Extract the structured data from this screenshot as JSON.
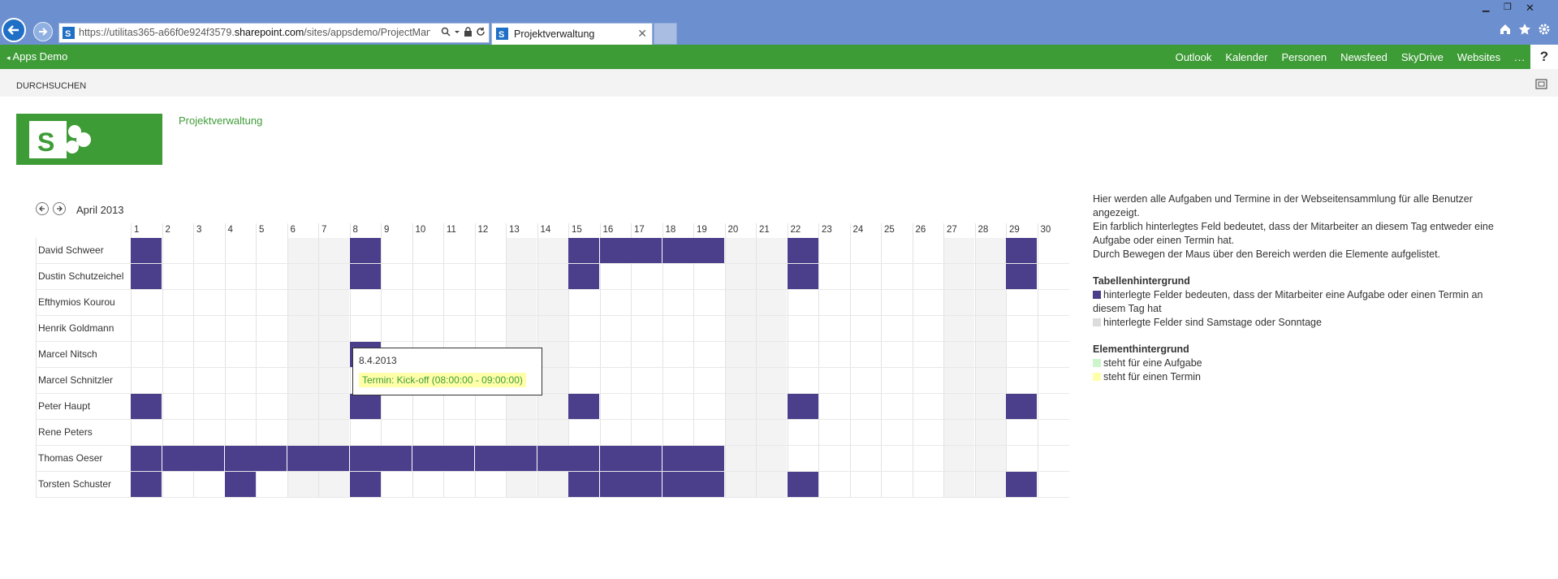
{
  "browser": {
    "url_prefix": "https://utilitas365-a66f0e924f3579.",
    "url_domain": "sharepoint.com",
    "url_path": "/sites/appsdemo/ProjectManage",
    "tab_title": "Projektverwaltung"
  },
  "suite": {
    "site_link": "Apps Demo",
    "nav": [
      "Outlook",
      "Kalender",
      "Personen",
      "Newsfeed",
      "SkyDrive",
      "Websites"
    ],
    "more": "...",
    "help": "?"
  },
  "ribbon": {
    "browse": "DURCHSUCHEN"
  },
  "site": {
    "title": "Projektverwaltung"
  },
  "calendar": {
    "month": "April 2013",
    "days": [
      "1",
      "2",
      "3",
      "4",
      "5",
      "6",
      "7",
      "8",
      "9",
      "10",
      "11",
      "12",
      "13",
      "14",
      "15",
      "16",
      "17",
      "18",
      "19",
      "20",
      "21",
      "22",
      "23",
      "24",
      "25",
      "26",
      "27",
      "28",
      "29",
      "30"
    ],
    "weekend_days": [
      6,
      7,
      13,
      14,
      20,
      21,
      27,
      28
    ],
    "rows": [
      {
        "name": "David Schweer",
        "busy": [
          1,
          8,
          15,
          16,
          17,
          18,
          19,
          22,
          29
        ]
      },
      {
        "name": "Dustin Schutzeichel",
        "busy": [
          1,
          8,
          15,
          22,
          29
        ]
      },
      {
        "name": "Efthymios Kourou",
        "busy": []
      },
      {
        "name": "Henrik Goldmann",
        "busy": []
      },
      {
        "name": "Marcel Nitsch",
        "busy": [
          8
        ]
      },
      {
        "name": "Marcel Schnitzler",
        "busy": []
      },
      {
        "name": "Peter Haupt",
        "busy": [
          1,
          8,
          15,
          22,
          29
        ]
      },
      {
        "name": "Rene Peters",
        "busy": []
      },
      {
        "name": "Thomas Oeser",
        "busy": [
          1,
          2,
          3,
          4,
          5,
          6,
          7,
          8,
          9,
          10,
          11,
          12,
          13,
          14,
          15,
          16,
          17,
          18,
          19
        ]
      },
      {
        "name": "Torsten Schuster",
        "busy": [
          1,
          4,
          8,
          15,
          16,
          17,
          18,
          19,
          22,
          29
        ]
      }
    ],
    "tooltip": {
      "date": "8.4.2013",
      "entry": "Termin: Kick-off (08:00:00 - 09:00:00)"
    }
  },
  "info": {
    "intro": "Hier werden alle Aufgaben und Termine in der Webseitensammlung für alle Benutzer angezeigt.",
    "line2": "Ein farblich hinterlegtes Feld bedeutet, dass der Mitarbeiter an diesem Tag entweder eine Aufgabe oder einen Termin hat.",
    "line3": "Durch Bewegen der Maus über den Bereich werden die Elemente aufgelistet.",
    "table_bg_title": "Tabellenhintergrund",
    "table_bg_busy": "hinterlegte Felder bedeuten, dass der Mitarbeiter eine Aufgabe oder einen Termin an diesem Tag hat",
    "table_bg_weekend": "hinterlegte Felder sind Samstage oder Sonntage",
    "element_bg_title": "Elementhintergrund",
    "element_bg_task": "steht für eine Aufgabe",
    "element_bg_event": "steht für einen Termin"
  },
  "colors": {
    "suitebar": "#3e9c37",
    "busy": "#4b3f8c",
    "weekend": "#f3f3f3",
    "task": "#ccf5cc",
    "event": "#ffffaa"
  }
}
